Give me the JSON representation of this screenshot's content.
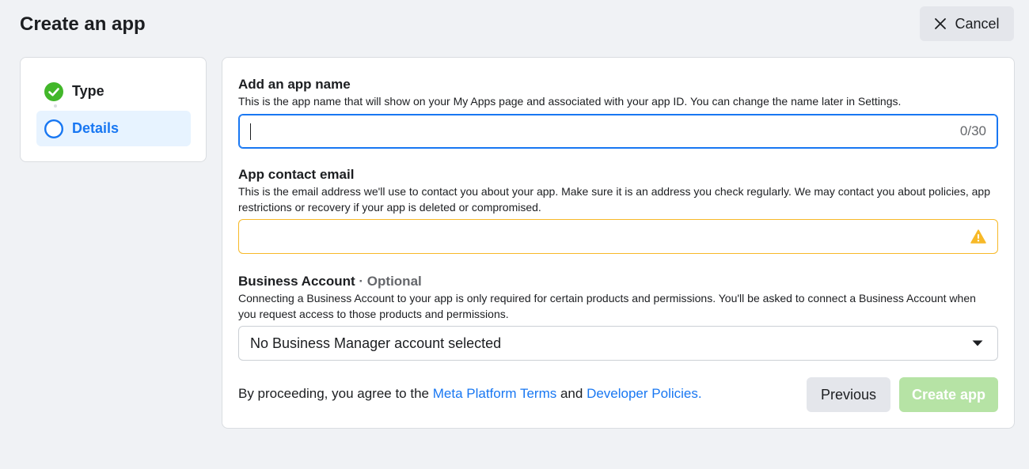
{
  "header": {
    "title": "Create an app",
    "cancel_label": "Cancel",
    "cancel_icon": "close-icon"
  },
  "steps": [
    {
      "label": "Type",
      "state": "completed",
      "icon": "check-circle-icon"
    },
    {
      "label": "Details",
      "state": "current",
      "icon": "circle-outline-icon"
    }
  ],
  "form": {
    "app_name": {
      "title": "Add an app name",
      "description": "This is the app name that will show on your My Apps page and associated with your app ID. You can change the name later in Settings.",
      "value": "",
      "counter": "0/30"
    },
    "contact_email": {
      "title": "App contact email",
      "description": "This is the email address we'll use to contact you about your app. Make sure it is an address you check regularly. We may contact you about policies, app restrictions or recovery if your app is deleted or compromised.",
      "value": "",
      "status_icon": "warning-icon"
    },
    "business_account": {
      "title": "Business Account",
      "optional_label": "· Optional",
      "description": "Connecting a Business Account to your app is only required for certain products and permissions. You'll be asked to connect a Business Account when you request access to those products and permissions.",
      "selected": "No Business Manager account selected"
    },
    "terms": {
      "prefix": "By proceeding, you agree to the ",
      "link1": "Meta Platform Terms",
      "middle": " and ",
      "link2": "Developer Policies."
    },
    "previous_label": "Previous",
    "create_label": "Create app"
  },
  "colors": {
    "accent": "#1877f2",
    "success": "#42b72a",
    "warning": "#f7b928",
    "create_disabled": "#b6e3a5"
  }
}
